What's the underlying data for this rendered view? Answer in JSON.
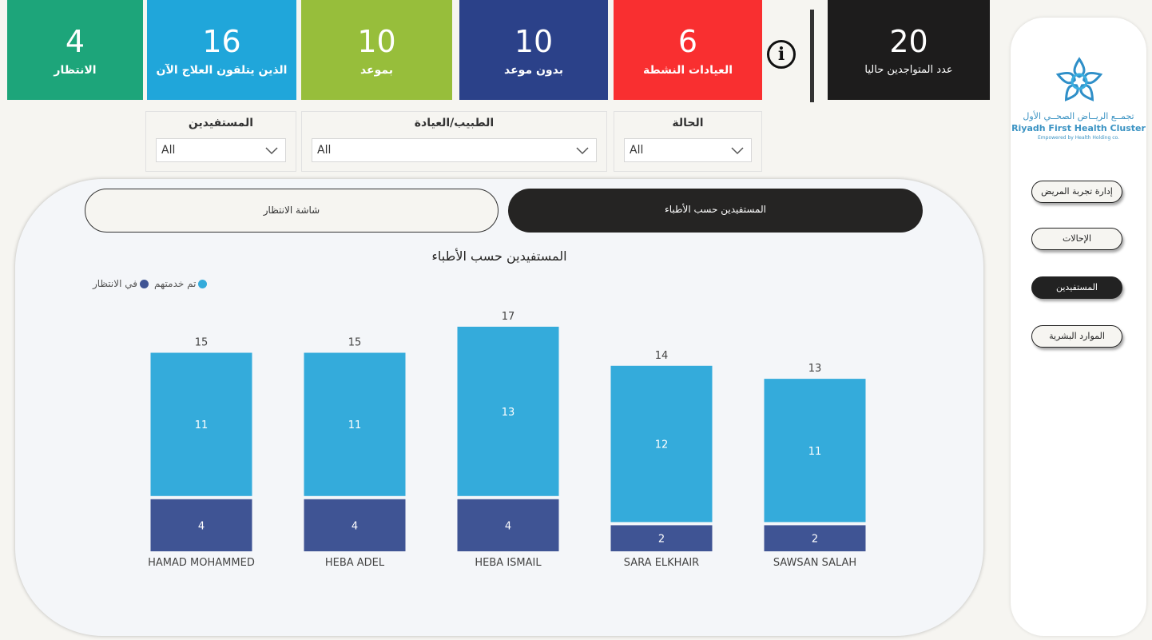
{
  "kpis": [
    {
      "value": "4",
      "label": "الانتظار",
      "color": "#1da57a"
    },
    {
      "value": "16",
      "label": "الذين يتلقون العلاج الآن",
      "color": "#20a6da"
    },
    {
      "value": "10",
      "label": "بموعد",
      "color": "#97be3b"
    },
    {
      "value": "10",
      "label": "بدون موعد",
      "color": "#2b4189"
    },
    {
      "value": "6",
      "label": "العيادات النشطة",
      "color": "#f92f30"
    },
    {
      "value": "20",
      "label": "عدد المتواجدين حاليا",
      "color": "#1d1c1c"
    }
  ],
  "info_icon": "info-icon",
  "filters": [
    {
      "title": "المستفيدين",
      "value": "All"
    },
    {
      "title": "الطبيب/العيادة",
      "value": "All"
    },
    {
      "title": "الحالة",
      "value": "All"
    }
  ],
  "logo": {
    "ar": "تجمــع الريــاض الصحــي الأول",
    "en": "Riyadh First Health Cluster",
    "sub": "Empowered by Health Holding co."
  },
  "nav": [
    {
      "label": "إدارة تجربة المريض",
      "active": false
    },
    {
      "label": "الإحالات",
      "active": false
    },
    {
      "label": "المستفيدين",
      "active": true
    },
    {
      "label": "الموارد البشرية",
      "active": false
    }
  ],
  "tabs": {
    "waiting_screen": "شاشة الانتظار",
    "beneficiaries_by_doctor": "المستفيدين حسب الأطباء"
  },
  "chart_data": {
    "type": "bar",
    "stacked": true,
    "title": "المستفيدين حسب الأطباء",
    "categories": [
      "HAMAD MOHAMMED",
      "HEBA ADEL",
      "HEBA ISMAIL",
      "SARA ELKHAIR",
      "SAWSAN SALAH"
    ],
    "series": [
      {
        "name": "في الانتظار",
        "values": [
          4,
          4,
          4,
          2,
          2
        ],
        "color": "#3f5494"
      },
      {
        "name": "تم خدمتهم",
        "values": [
          11,
          11,
          13,
          12,
          11
        ],
        "color": "#34abdb"
      }
    ],
    "totals": [
      15,
      15,
      17,
      14,
      13
    ],
    "legend_position": "top-left",
    "grid": false
  }
}
